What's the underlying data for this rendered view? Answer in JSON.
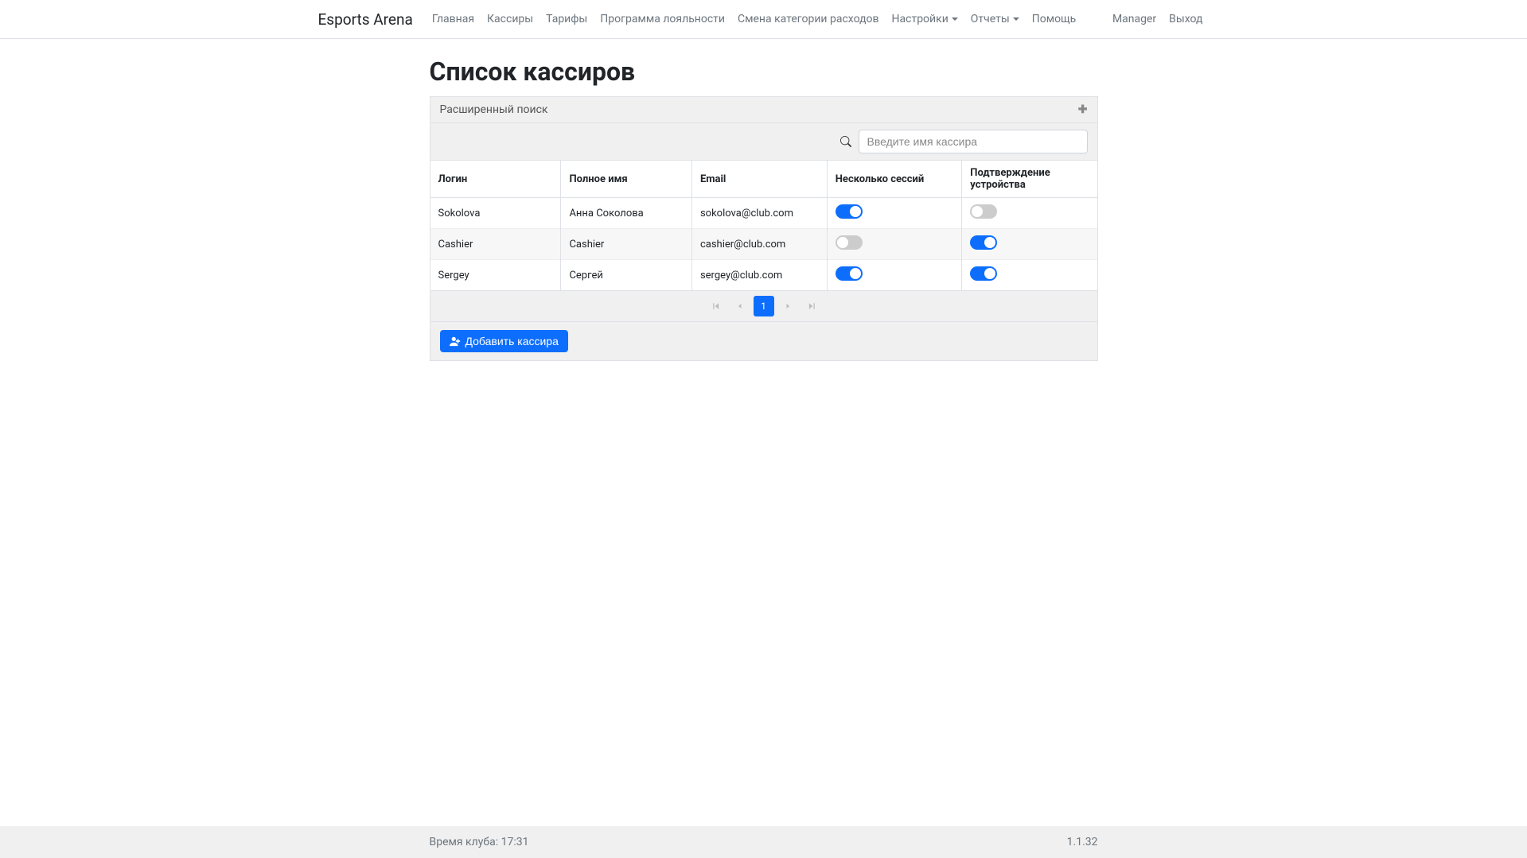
{
  "brand": "Esports Arena",
  "nav": {
    "items": [
      {
        "label": "Главная"
      },
      {
        "label": "Кассиры"
      },
      {
        "label": "Тарифы"
      },
      {
        "label": "Программа лояльности"
      },
      {
        "label": "Смена категории расходов"
      },
      {
        "label": "Настройки",
        "dropdown": true
      },
      {
        "label": "Отчеты",
        "dropdown": true
      },
      {
        "label": "Помощь"
      }
    ],
    "right": [
      {
        "label": "Manager"
      },
      {
        "label": "Выход"
      }
    ]
  },
  "page_title": "Список кассиров",
  "adv_search": {
    "label": "Расширенный поиск"
  },
  "search": {
    "placeholder": "Введите имя кассира"
  },
  "table": {
    "headers": {
      "login": "Логин",
      "name": "Полное имя",
      "email": "Email",
      "sessions": "Несколько сессий",
      "confirm": "Подтверждение устройства"
    },
    "rows": [
      {
        "login": "Sokolova",
        "name": "Анна Соколова",
        "email": "sokolova@club.com",
        "sessions": true,
        "confirm": false
      },
      {
        "login": "Cashier",
        "name": "Cashier",
        "email": "cashier@club.com",
        "sessions": false,
        "confirm": true
      },
      {
        "login": "Sergey",
        "name": "Сергей",
        "email": "sergey@club.com",
        "sessions": true,
        "confirm": true
      }
    ]
  },
  "pagination": {
    "current": "1"
  },
  "add_button": "Добавить кассира",
  "footer": {
    "club_time_label": "Время клуба:",
    "club_time_value": "17:31",
    "version": "1.1.32"
  },
  "icons": {
    "search": "search-icon",
    "plus": "plus-icon",
    "userplus": "userplus-icon"
  }
}
